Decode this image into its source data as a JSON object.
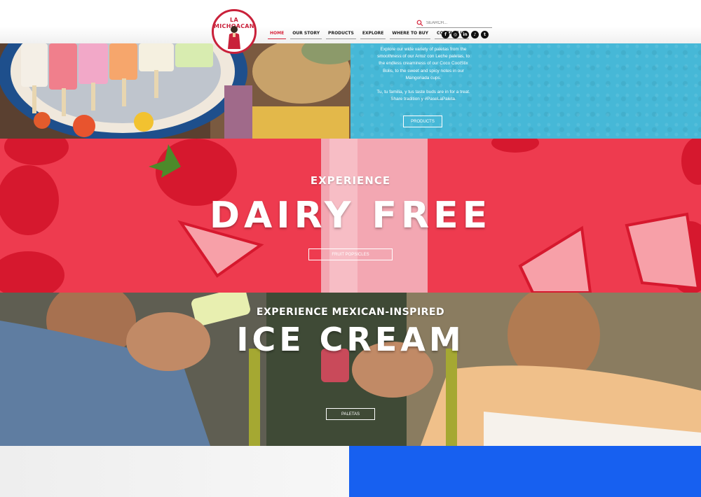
{
  "brand": {
    "logo_text": "LA MICHOACANA"
  },
  "nav": {
    "items": [
      "HOME",
      "OUR STORY",
      "PRODUCTS",
      "EXPLORE",
      "WHERE TO BUY",
      "CONTACT US"
    ],
    "active_index": 0
  },
  "search": {
    "placeholder": "SEARCH..."
  },
  "social": {
    "icons": [
      "facebook-icon",
      "instagram-icon",
      "linkedin-icon",
      "tiktok-icon",
      "twitter-icon"
    ],
    "glyphs": [
      "f",
      "◎",
      "in",
      "♪",
      "t"
    ]
  },
  "promo": {
    "paragraph1": "Explore our wide variety of paletas from the smoothness of our Arroz con Leche paletas, to the endless creaminess of our Coco CoolStix Bolis, to the sweet and spicy notes in our Mangonada cups.",
    "paragraph2": "Tu, tu familia, y tus taste buds are in for a treat. Share tradition y #PaseLaPaleta.",
    "button": "PRODUCTS"
  },
  "dairy_free": {
    "eyebrow": "EXPERIENCE",
    "heading": "DAIRY FREE",
    "button": "FRUIT POPSICLES"
  },
  "ice_cream": {
    "eyebrow": "EXPERIENCE MEXICAN-INSPIRED",
    "heading": "ICE CREAM",
    "button": "PALETAS"
  },
  "colors": {
    "accent_red": "#d6243b",
    "sky_blue": "#46b8d7",
    "strawberry_red": "#ee3b4f",
    "bottom_blue": "#1760f0"
  }
}
